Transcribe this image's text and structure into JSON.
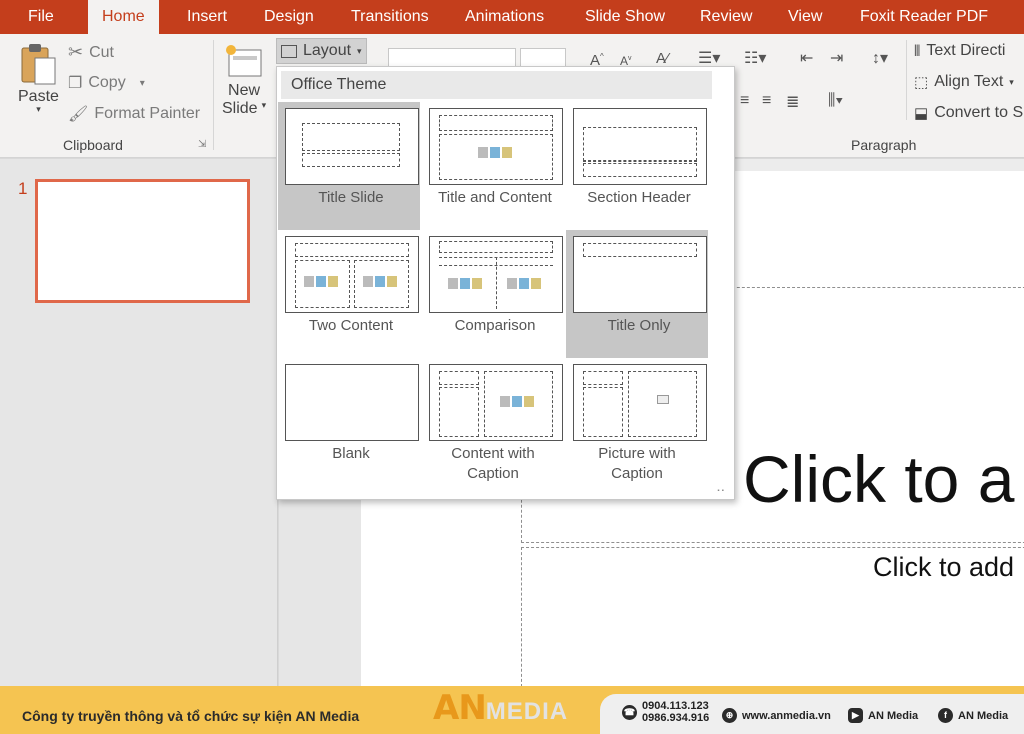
{
  "tabs": [
    "File",
    "Home",
    "Insert",
    "Design",
    "Transitions",
    "Animations",
    "Slide Show",
    "Review",
    "View",
    "Foxit Reader PDF"
  ],
  "clipboard": {
    "paste": "Paste",
    "cut": "Cut",
    "copy": "Copy",
    "format_painter": "Format Painter",
    "label": "Clipboard"
  },
  "slides": {
    "new_slide_line1": "New",
    "new_slide_line2": "Slide",
    "layout": "Layout"
  },
  "paragraph": {
    "text_direction": "Text Directi",
    "align_text": "Align Text",
    "convert_to": "Convert to S",
    "label": "Paragraph"
  },
  "layout_menu": {
    "header": "Office Theme",
    "selected": "Title Only",
    "hover": "Title Slide",
    "items": [
      {
        "label": "Title Slide"
      },
      {
        "label": "Title and Content"
      },
      {
        "label": "Section Header"
      },
      {
        "label": "Two Content"
      },
      {
        "label": "Comparison"
      },
      {
        "label": "Title Only"
      },
      {
        "label": "Blank"
      },
      {
        "label": "Content with Caption"
      },
      {
        "label": "Picture with Caption"
      }
    ]
  },
  "slide_panel": {
    "slide_number": "1"
  },
  "slide": {
    "title_placeholder": "Click to a",
    "subtitle_placeholder": "Click to add"
  },
  "footer": {
    "company": "Công ty truyền thông và tổ chức sự kiện AN Media",
    "logo_an": "AN",
    "logo_media": "MEDIA",
    "phone1": "0904.113.123",
    "phone2": "0986.934.916",
    "website": "www.anmedia.vn",
    "youtube": "AN Media",
    "facebook": "AN Media"
  },
  "colors": {
    "accent": "#c43e1c",
    "selection": "#c6c6c6",
    "footer": "#f5c451"
  }
}
